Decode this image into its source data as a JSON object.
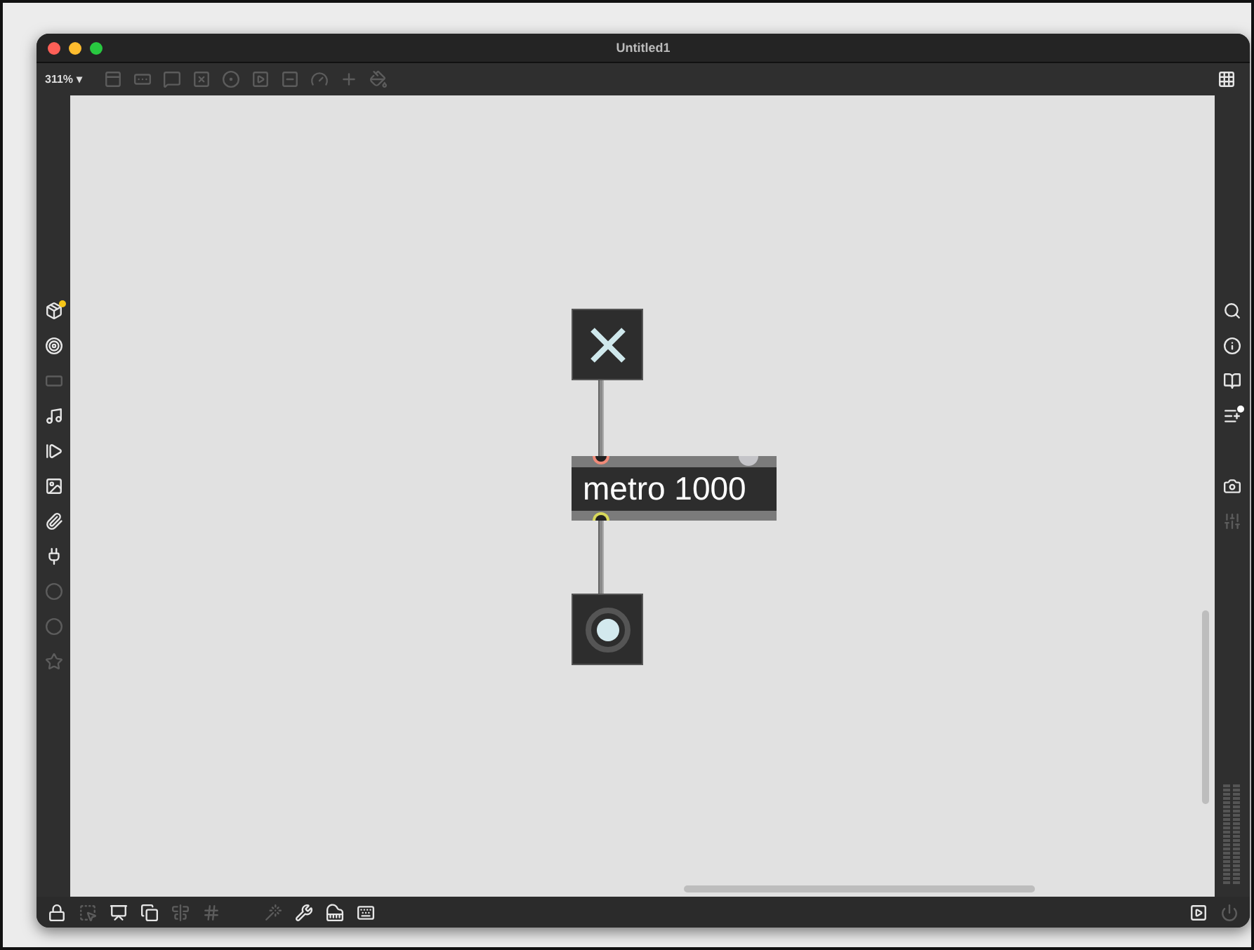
{
  "window": {
    "title": "Untitled1"
  },
  "toolbar": {
    "zoom": "311%",
    "zoom_caret": "▾",
    "tools": [
      {
        "kind": "panel",
        "disabled": true
      },
      {
        "kind": "comment-box",
        "disabled": true
      },
      {
        "kind": "speech",
        "disabled": true
      },
      {
        "kind": "toggle",
        "disabled": true
      },
      {
        "kind": "bang",
        "disabled": true
      },
      {
        "kind": "play",
        "disabled": true
      },
      {
        "kind": "slider",
        "disabled": true
      },
      {
        "kind": "dial",
        "disabled": true
      },
      {
        "kind": "plus",
        "disabled": true
      },
      {
        "kind": "paint",
        "disabled": true
      }
    ],
    "right_tool": {
      "kind": "grid",
      "disabled": false
    }
  },
  "left_sidebar": [
    {
      "kind": "package",
      "disabled": false,
      "badge": true
    },
    {
      "kind": "target",
      "disabled": false,
      "badge": false
    },
    {
      "kind": "tape",
      "disabled": true,
      "badge": false
    },
    {
      "kind": "note",
      "disabled": false,
      "badge": false
    },
    {
      "kind": "sequence",
      "disabled": false,
      "badge": false
    },
    {
      "kind": "image",
      "disabled": false,
      "badge": false
    },
    {
      "kind": "clip",
      "disabled": false,
      "badge": false
    },
    {
      "kind": "plug",
      "disabled": false,
      "badge": false
    },
    {
      "kind": "dot",
      "disabled": true,
      "badge": false
    },
    {
      "kind": "dot",
      "disabled": true,
      "badge": false
    },
    {
      "kind": "star",
      "disabled": true,
      "badge": false
    }
  ],
  "right_sidebar": {
    "top": [
      {
        "kind": "search",
        "disabled": false,
        "badge": false
      },
      {
        "kind": "info",
        "disabled": false,
        "badge": false
      },
      {
        "kind": "book",
        "disabled": false,
        "badge": false
      },
      {
        "kind": "list",
        "disabled": false,
        "badge": true
      }
    ],
    "lower": [
      {
        "kind": "camera",
        "disabled": false,
        "badge": false
      },
      {
        "kind": "mixer",
        "disabled": true,
        "badge": false
      }
    ]
  },
  "patch": {
    "toggle": {
      "on": true
    },
    "metro": {
      "text": "metro 1000"
    },
    "button": {
      "lit": true
    }
  },
  "bottom_bar": {
    "left": [
      {
        "kind": "lock",
        "disabled": false
      },
      {
        "kind": "select",
        "disabled": true
      },
      {
        "kind": "presentation",
        "disabled": false
      },
      {
        "kind": "windows",
        "disabled": false
      },
      {
        "kind": "align",
        "disabled": true
      },
      {
        "kind": "hash",
        "disabled": true
      }
    ],
    "middle": [
      {
        "kind": "wand",
        "disabled": true
      },
      {
        "kind": "wrench",
        "disabled": false
      },
      {
        "kind": "piano",
        "disabled": false
      },
      {
        "kind": "keyboard",
        "disabled": false
      }
    ],
    "right": [
      {
        "kind": "play",
        "disabled": false
      },
      {
        "kind": "power",
        "disabled": true
      }
    ]
  }
}
